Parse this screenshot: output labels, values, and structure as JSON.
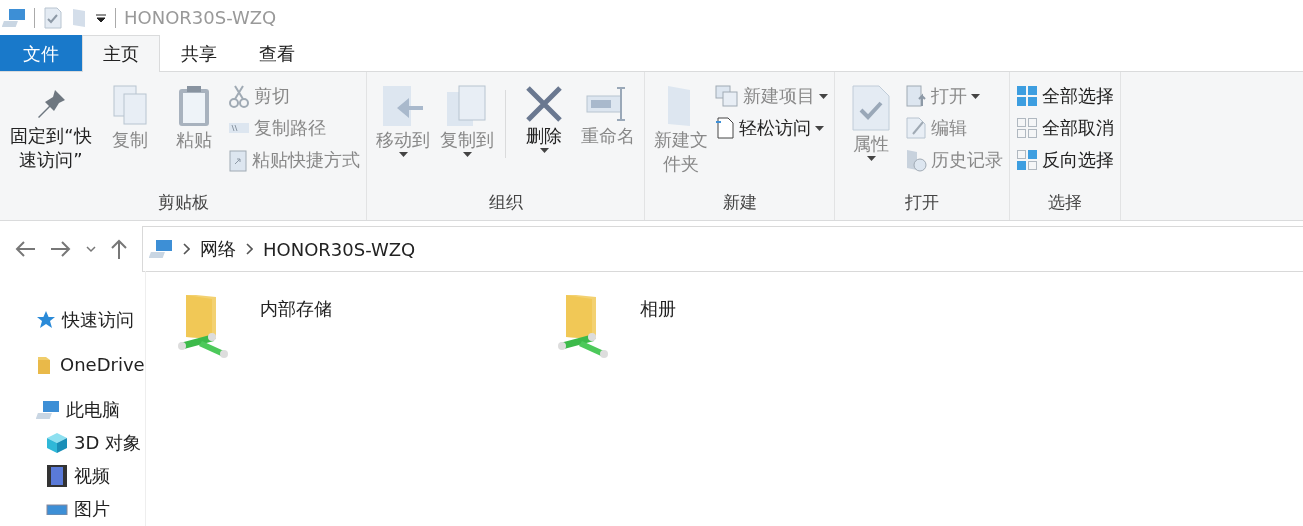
{
  "window": {
    "title": "HONOR30S-WZQ"
  },
  "tabs": [
    {
      "label": "文件",
      "kind": "file",
      "selected": false
    },
    {
      "label": "主页",
      "kind": "tab",
      "selected": true
    },
    {
      "label": "共享",
      "kind": "tab",
      "selected": false
    },
    {
      "label": "查看",
      "kind": "tab",
      "selected": false
    }
  ],
  "ribbon": {
    "groups": [
      {
        "label": "剪贴板",
        "columns": [
          {
            "kind": "large",
            "label": "固定到“快速访问”",
            "disabled": false,
            "dropdown": false
          },
          {
            "kind": "large",
            "label": "复制",
            "disabled": true,
            "dropdown": false
          },
          {
            "kind": "large",
            "label": "粘贴",
            "disabled": true,
            "dropdown": false
          },
          {
            "kind": "stack",
            "items": [
              {
                "label": "剪切",
                "disabled": true,
                "dropdown": false
              },
              {
                "label": "复制路径",
                "disabled": true,
                "dropdown": false
              },
              {
                "label": "粘贴快捷方式",
                "disabled": true,
                "dropdown": false
              }
            ]
          }
        ]
      },
      {
        "label": "组织",
        "columns": [
          {
            "kind": "large",
            "label": "移动到",
            "disabled": true,
            "dropdown": true
          },
          {
            "kind": "large",
            "label": "复制到",
            "disabled": true,
            "dropdown": true
          },
          {
            "kind": "separator"
          },
          {
            "kind": "large",
            "label": "删除",
            "disabled": false,
            "dropdown": true
          },
          {
            "kind": "large",
            "label": "重命名",
            "disabled": true,
            "dropdown": false
          }
        ]
      },
      {
        "label": "新建",
        "columns": [
          {
            "kind": "large",
            "label": "新建文件夹",
            "disabled": true,
            "dropdown": false
          },
          {
            "kind": "stack",
            "items": [
              {
                "label": "新建项目",
                "disabled": true,
                "dropdown": true
              },
              {
                "label": "轻松访问",
                "disabled": false,
                "dropdown": true
              }
            ]
          }
        ]
      },
      {
        "label": "打开",
        "columns": [
          {
            "kind": "large",
            "label": "属性",
            "disabled": true,
            "dropdown": true
          },
          {
            "kind": "stack",
            "items": [
              {
                "label": "打开",
                "disabled": true,
                "dropdown": true
              },
              {
                "label": "编辑",
                "disabled": true,
                "dropdown": false
              },
              {
                "label": "历史记录",
                "disabled": true,
                "dropdown": false
              }
            ]
          }
        ]
      },
      {
        "label": "选择",
        "columns": [
          {
            "kind": "stack",
            "items": [
              {
                "label": "全部选择",
                "disabled": false,
                "dropdown": false
              },
              {
                "label": "全部取消",
                "disabled": false,
                "dropdown": false
              },
              {
                "label": "反向选择",
                "disabled": false,
                "dropdown": false
              }
            ]
          }
        ]
      }
    ]
  },
  "address": {
    "path": [
      "网络",
      "HONOR30S-WZQ"
    ]
  },
  "sidebar": {
    "items": [
      {
        "label": "快速访问",
        "kind": "quick"
      },
      {
        "label": "OneDrive",
        "kind": "cloud"
      },
      {
        "label": "此电脑",
        "kind": "pc",
        "children": [
          {
            "label": "3D 对象",
            "kind": "objects"
          },
          {
            "label": "视频",
            "kind": "video"
          },
          {
            "label": "图片",
            "kind": "pictures"
          }
        ]
      }
    ]
  },
  "content": {
    "folders": [
      {
        "label": "内部存储"
      },
      {
        "label": "相册"
      }
    ]
  }
}
